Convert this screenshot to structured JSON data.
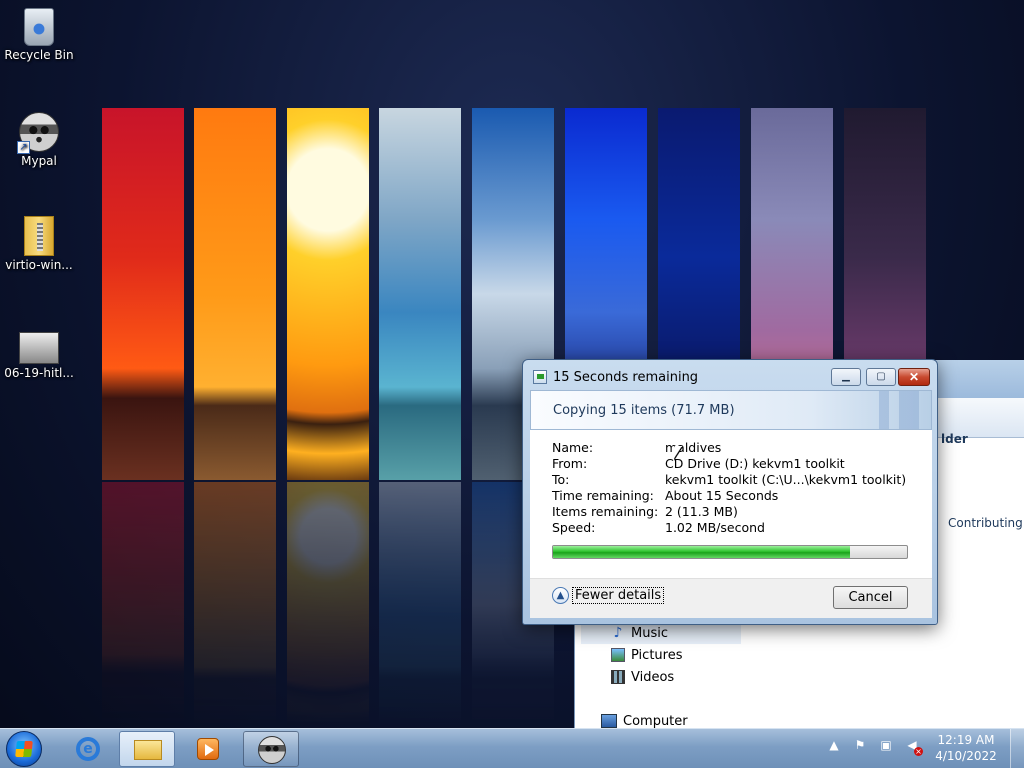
{
  "desktop": {
    "icons": [
      {
        "label": "Recycle Bin",
        "icon": "recycle-bin-icon"
      },
      {
        "label": "Mypal",
        "icon": "raccoon-icon"
      },
      {
        "label": "virtio-win...",
        "icon": "zip-folder-icon"
      },
      {
        "label": "06-19-hitl...",
        "icon": "photo-file-icon"
      }
    ]
  },
  "explorer": {
    "column_header": "lder",
    "contributing": "Contributing",
    "nav": [
      {
        "label": "Music",
        "icon": "music-icon"
      },
      {
        "label": "Pictures",
        "icon": "pictures-icon"
      },
      {
        "label": "Videos",
        "icon": "videos-icon"
      },
      {
        "label": "Computer",
        "icon": "computer-icon"
      }
    ]
  },
  "copy_dialog": {
    "title": "15 Seconds remaining",
    "minimize_label": "▁",
    "maximize_label": "▢",
    "close_label": "✕",
    "banner": "Copying 15 items (71.7 MB)",
    "details": [
      {
        "key": "Name:",
        "value": "maldives"
      },
      {
        "key": "From:",
        "value": "CD Drive (D:) kekvm1 toolkit"
      },
      {
        "key": "To:",
        "value": "kekvm1 toolkit (C:\\U...\\kekvm1 toolkit)"
      },
      {
        "key": "Time remaining:",
        "value": "About 15 Seconds"
      },
      {
        "key": "Items remaining:",
        "value": "2 (11.3 MB)"
      },
      {
        "key": "Speed:",
        "value": "1.02 MB/second"
      }
    ],
    "progress_percent": 84,
    "fewer_details": "Fewer details",
    "cancel": "Cancel"
  },
  "taskbar": {
    "apps": [
      {
        "name": "internet-explorer",
        "icon": "ie-icon"
      },
      {
        "name": "windows-explorer",
        "icon": "folder-icon",
        "active": true
      },
      {
        "name": "windows-media-player",
        "icon": "media-player-icon"
      },
      {
        "name": "mypal",
        "icon": "raccoon-icon",
        "open": true
      }
    ],
    "tray_icons": [
      "show-hidden-icons-icon",
      "action-center-flag-icon",
      "network-icon",
      "volume-muted-icon"
    ],
    "time": "12:19 AM",
    "date": "4/10/2022"
  }
}
